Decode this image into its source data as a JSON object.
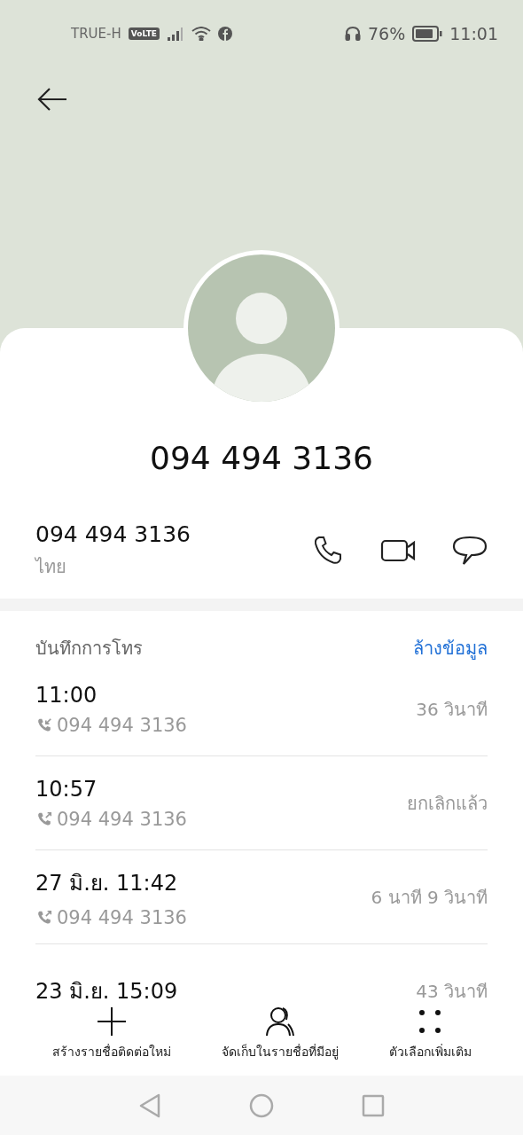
{
  "status_bar": {
    "carrier": "TRUE-H",
    "network_badge": "VoLTE",
    "battery": "76%",
    "time": "11:01"
  },
  "contact": {
    "name": "094 494 3136",
    "number": "094 494 3136",
    "location": "ไทย"
  },
  "call_log": {
    "title": "บันทึกการโทร",
    "clear_link": "ล้างข้อมูล",
    "entries": [
      {
        "time": "11:00",
        "kind": "incoming",
        "number": "094 494 3136",
        "duration": "36 วินาที"
      },
      {
        "time": "10:57",
        "kind": "outgoing",
        "number": "094 494 3136",
        "duration": "ยกเลิกแล้ว"
      },
      {
        "time": "27 มิ.ย. 11:42",
        "kind": "outgoing",
        "number": "094 494 3136",
        "duration": "6 นาที 9 วินาที"
      },
      {
        "time": "23 มิ.ย. 15:09",
        "duration": "43 วินาที"
      }
    ]
  },
  "actions": [
    {
      "kind": "create",
      "label": "สร้างรายชื่อติดต่อใหม่"
    },
    {
      "kind": "save",
      "label": "จัดเก็บในรายชื่อที่มีอยู่"
    },
    {
      "kind": "more",
      "label": "ตัวเลือกเพิ่มเติม"
    }
  ]
}
